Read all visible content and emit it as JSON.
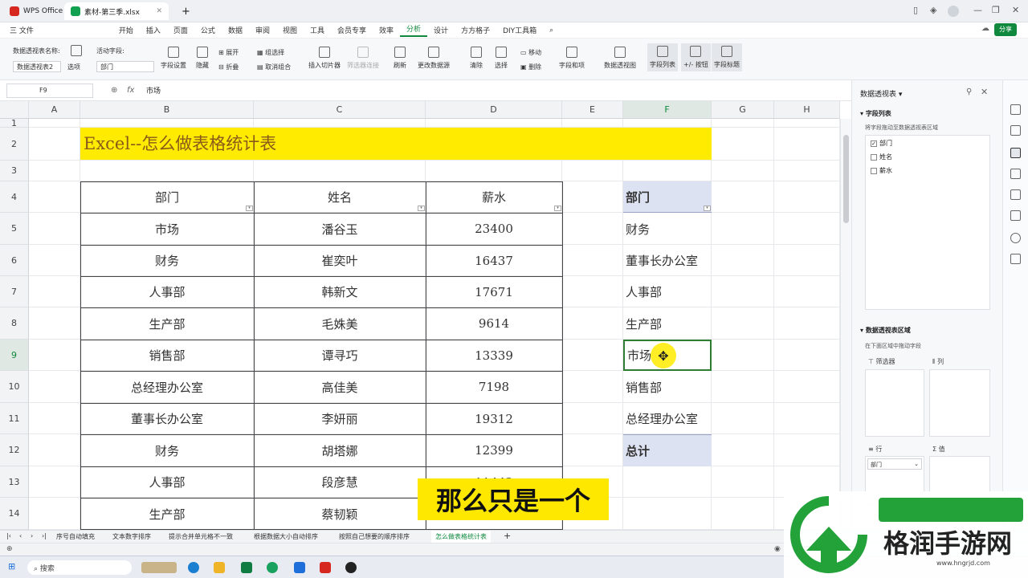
{
  "titlebar": {
    "app_tab": "WPS Office",
    "file_tab": "素材-第三季.xlsx",
    "new_tab": "+"
  },
  "menu": [
    "三 文件",
    "开始",
    "插入",
    "页面",
    "公式",
    "数据",
    "审阅",
    "视图",
    "工具",
    "会员专享",
    "效率",
    "分析",
    "设计",
    "方方格子",
    "DIY工具箱"
  ],
  "menu_active": "分析",
  "share_label": "分享",
  "ribbon": {
    "pivot_name_label": "数据透视表名称:",
    "pivot_name_value": "数据透视表2",
    "options": "选项",
    "active_field_label": "活动字段:",
    "active_field_value": "部门",
    "field_settings": "字段设置",
    "hide": "隐藏",
    "expand": "展开",
    "collapse": "折叠",
    "group_select": "组选择",
    "ungroup": "取消组合",
    "insert_slicer": "插入切片器",
    "filter_conn": "筛选器连接",
    "refresh": "刷新",
    "change_source": "更改数据源",
    "clear": "清除",
    "select": "选择",
    "move": "移动",
    "delete": "删除",
    "fields_items": "字段和项",
    "pivot_chart": "数据透视图",
    "field_list": "字段列表",
    "plus_minus": "+/- 按钮",
    "field_headers": "字段标题"
  },
  "formula_bar": {
    "cell_ref": "F9",
    "fx": "fx",
    "content": "市场"
  },
  "columns": [
    "A",
    "B",
    "C",
    "D",
    "E",
    "F",
    "G",
    "H"
  ],
  "rows": [
    "1",
    "2",
    "3",
    "4",
    "5",
    "6",
    "7",
    "8",
    "9",
    "10",
    "11",
    "12",
    "13",
    "14"
  ],
  "sheet": {
    "title": "Excel--怎么做表格统计表",
    "headers": [
      "部门",
      "姓名",
      "薪水"
    ],
    "data": [
      [
        "市场",
        "潘谷玉",
        "23400"
      ],
      [
        "财务",
        "崔奕叶",
        "16437"
      ],
      [
        "人事部",
        "韩新文",
        "17671"
      ],
      [
        "生产部",
        "毛姝美",
        "9614"
      ],
      [
        "销售部",
        "谭寻巧",
        "13339"
      ],
      [
        "总经理办公室",
        "高佳美",
        "7198"
      ],
      [
        "董事长办公室",
        "李妍丽",
        "19312"
      ],
      [
        "财务",
        "胡塔娜",
        "12399"
      ],
      [
        "人事部",
        "段彦慧",
        "11442"
      ],
      [
        "生产部",
        "蔡韧颖",
        ""
      ]
    ],
    "pivot_header": "部门",
    "pivot_items": [
      "财务",
      "董事长办公室",
      "人事部",
      "生产部",
      "市场",
      "销售部",
      "总经理办公室"
    ],
    "pivot_total": "总计"
  },
  "subtitle": "那么只是一个",
  "right_panel": {
    "title": "数据透视表",
    "field_list_title": "字段列表",
    "drag_hint": "将字段拖动至数据透视表区域",
    "fields": [
      {
        "name": "部门",
        "checked": true
      },
      {
        "name": "姓名",
        "checked": false
      },
      {
        "name": "薪水",
        "checked": false
      }
    ],
    "areas_title": "数据透视表区域",
    "areas_hint": "在下面区域中拖动字段",
    "filter": "筛选器",
    "col": "列",
    "row": "行",
    "value": "值",
    "row_field": "部门"
  },
  "sheet_tabs": [
    "序号自动填充",
    "文本数字排序",
    "提示合并单元格不一致",
    "根据数据大小自动排序",
    "按照自己想要的顺序排序",
    "怎么做表格统计表"
  ],
  "active_sheet_tab": "怎么做表格统计表",
  "taskbar": {
    "search": "搜索"
  },
  "watermark": {
    "brand": "格润手游网",
    "url": "www.hngrjd.com"
  },
  "colors": {
    "accent": "#10893e",
    "title_fill": "#ffeb00",
    "pivot_header_fill": "#dde2f2"
  }
}
